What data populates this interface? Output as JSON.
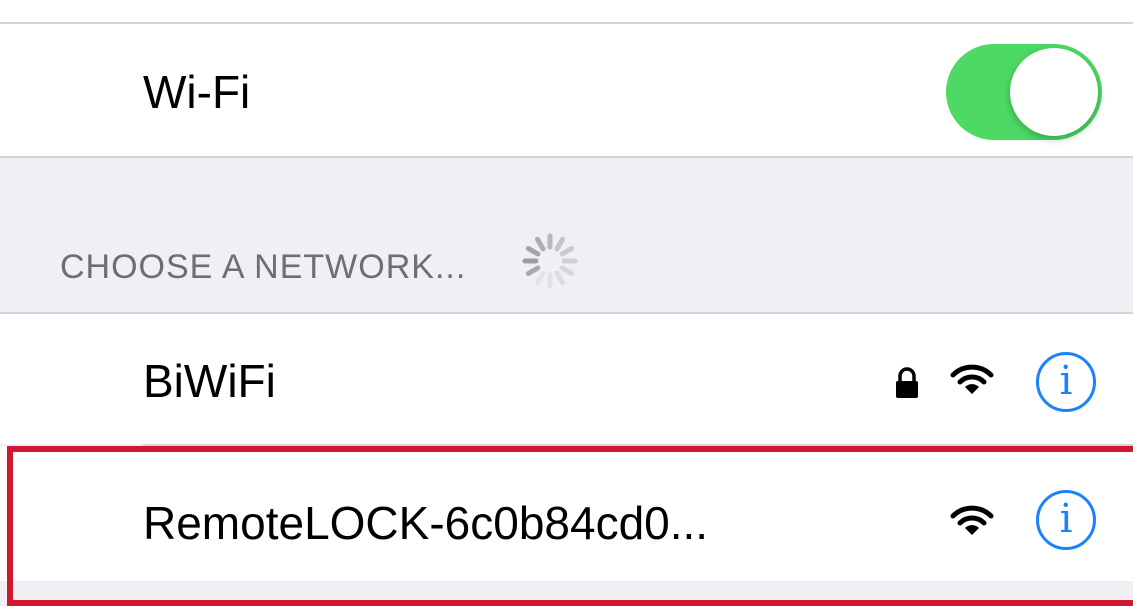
{
  "wifi": {
    "label": "Wi-Fi",
    "enabled": true
  },
  "section": {
    "header": "CHOOSE A NETWORK..."
  },
  "networks": [
    {
      "name": "BiWiFi",
      "secured": true,
      "icons": [
        "lock-icon",
        "wifi-icon",
        "info-icon"
      ]
    },
    {
      "name": "RemoteLOCK-6c0b84cd0...",
      "secured": false,
      "icons": [
        "wifi-icon",
        "info-icon"
      ]
    }
  ],
  "info_glyph": "i",
  "colors": {
    "toggle_on": "#4cd964",
    "info_blue": "#1a82fb",
    "highlight_red": "#d0192e",
    "grouped_background": "#efeff4",
    "section_text": "#6d6d72"
  }
}
